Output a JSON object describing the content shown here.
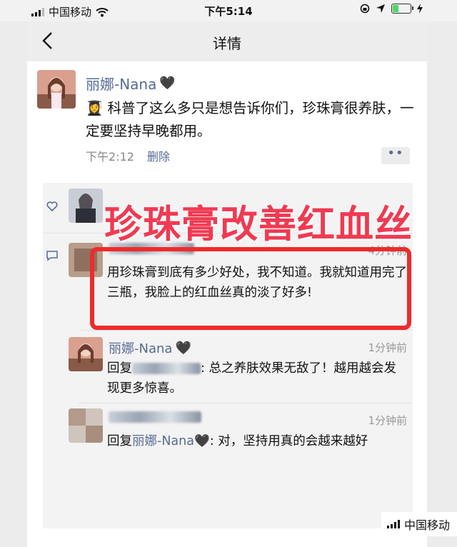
{
  "status_bar": {
    "carrier": "中国移动",
    "time": "下午5:14"
  },
  "nav": {
    "title": "详情",
    "back_icon": "chevron-left-icon"
  },
  "post": {
    "author": "丽娜-Nana",
    "author_emoji": "🖤",
    "text_emoji": "👩‍🎓",
    "text": "科普了这么多只是想告诉你们，珍珠膏很养肤，一定要坚持早晚都用。",
    "time": "下午2:12",
    "delete_label": "删除",
    "more_label": "••"
  },
  "overlay": {
    "headline": "珍珠膏改善红血丝",
    "highlight_color": "#ee2b2b"
  },
  "comments": [
    {
      "time": "4分钟前",
      "text": "用珍珠膏到底有多少好处，我不知道。我就知道用完了三瓶，我脸上的红血丝真的淡了好多!"
    },
    {
      "author": "丽娜-Nana",
      "author_emoji": "🖤",
      "time": "1分钟前",
      "reply_prefix": "回复",
      "text": "总之养肤效果无敌了！越用越会发现更多惊喜。"
    },
    {
      "time": "1分钟前",
      "reply_prefix": "回复",
      "reply_to": "丽娜-Nana",
      "reply_to_emoji": "🖤",
      "text": "对，坚持用真的会越来越好"
    }
  ],
  "watermark": {
    "carrier": "中国移动"
  },
  "colors": {
    "link": "#576b95",
    "headline": "#f03a52"
  }
}
